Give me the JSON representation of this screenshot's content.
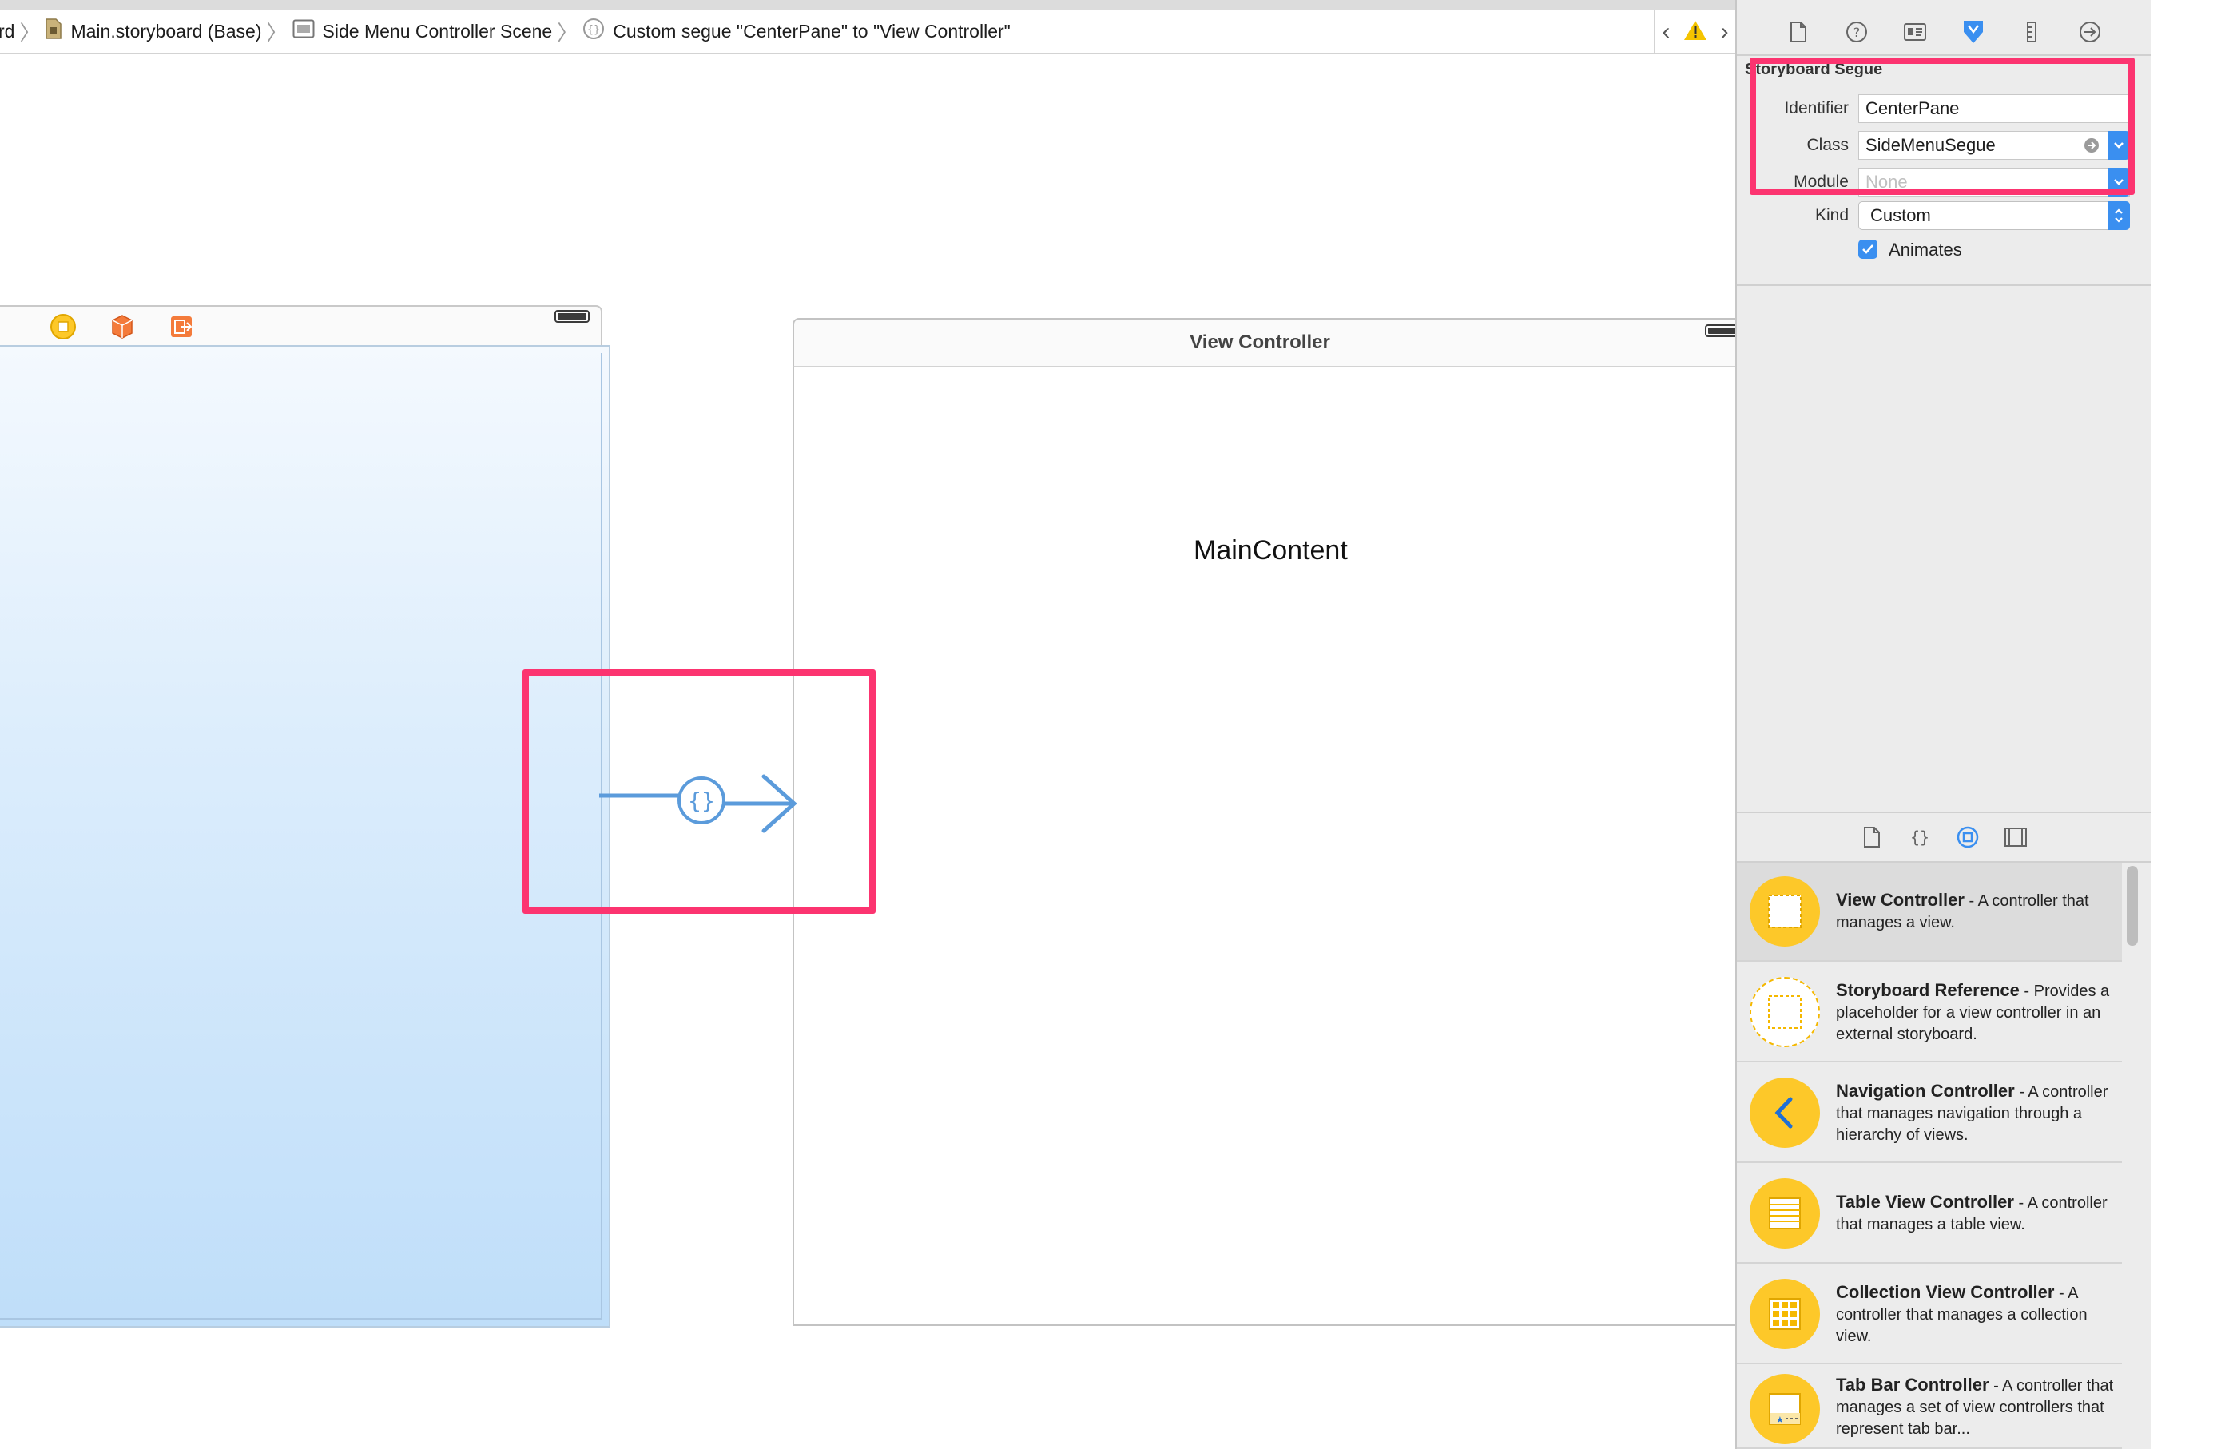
{
  "breadcrumb": {
    "items": [
      {
        "label": "rd",
        "icon": "none"
      },
      {
        "label": "Main.storyboard (Base)",
        "icon": "storyboard-file-icon"
      },
      {
        "label": "Side Menu Controller Scene",
        "icon": "scene-icon"
      },
      {
        "label": "Custom segue \"CenterPane\" to \"View Controller\"",
        "icon": "segue-icon"
      }
    ]
  },
  "canvas": {
    "view_controller_title": "View Controller",
    "main_content_label": "MainContent"
  },
  "inspector": {
    "section_title": "Storyboard Segue",
    "identifier_label": "Identifier",
    "identifier_value": "CenterPane",
    "class_label": "Class",
    "class_value": "SideMenuSegue",
    "module_label": "Module",
    "module_placeholder": "None",
    "kind_label": "Kind",
    "kind_value": "Custom",
    "animates_label": "Animates",
    "animates_checked": true
  },
  "library": {
    "items": [
      {
        "title": "View Controller",
        "desc": " - A controller that manages a view.",
        "icon": "view-controller-icon",
        "selected": true
      },
      {
        "title": "Storyboard Reference",
        "desc": " - Provides a placeholder for a view controller in an external storyboard.",
        "icon": "storyboard-reference-icon",
        "selected": false
      },
      {
        "title": "Navigation Controller",
        "desc": " - A controller that manages navigation through a hierarchy of views.",
        "icon": "navigation-controller-icon",
        "selected": false
      },
      {
        "title": "Table View Controller",
        "desc": " - A controller that manages a table view.",
        "icon": "table-view-controller-icon",
        "selected": false
      },
      {
        "title": "Collection View Controller",
        "desc": " - A controller that manages a collection view.",
        "icon": "collection-view-controller-icon",
        "selected": false
      },
      {
        "title": "Tab Bar Controller",
        "desc": " - A controller that manages a set of view controllers that represent tab bar...",
        "icon": "tab-bar-controller-icon",
        "selected": false
      }
    ]
  },
  "colors": {
    "accent": "#3a8ff0",
    "highlight": "#fc3470",
    "library_icon": "#fdc829",
    "segue_line": "#5b9bdb"
  }
}
